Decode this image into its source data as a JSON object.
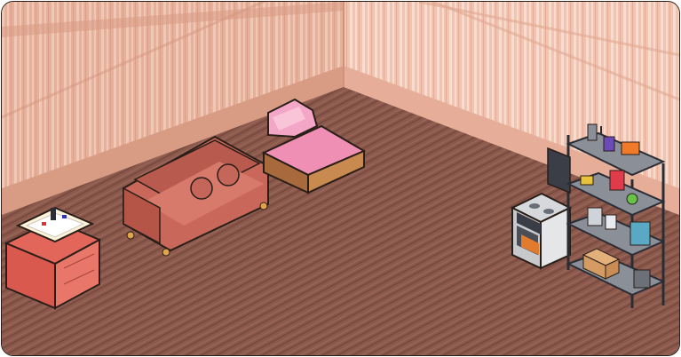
{
  "scene": {
    "kind": "isometric pixel-art room",
    "colors": {
      "wall_left": "#e6b09a",
      "wall_left_stripe": "#f1c8b5",
      "wall_right": "#f0c4b0",
      "wall_right_stripe": "#f9dccd",
      "baseboard": "#d89b84",
      "floor": "#8c5a4d",
      "floor_line": "#7a4b40",
      "outline": "#2a1e18"
    },
    "objects": [
      {
        "id": "sink-cabinet",
        "icon": "sink-cabinet-icon"
      },
      {
        "id": "sofa",
        "icon": "sofa-icon"
      },
      {
        "id": "lounge-chair",
        "icon": "chaise-lounge-icon"
      },
      {
        "id": "stove",
        "icon": "stove-icon"
      },
      {
        "id": "metal-shelf",
        "icon": "shelf-icon"
      }
    ]
  }
}
